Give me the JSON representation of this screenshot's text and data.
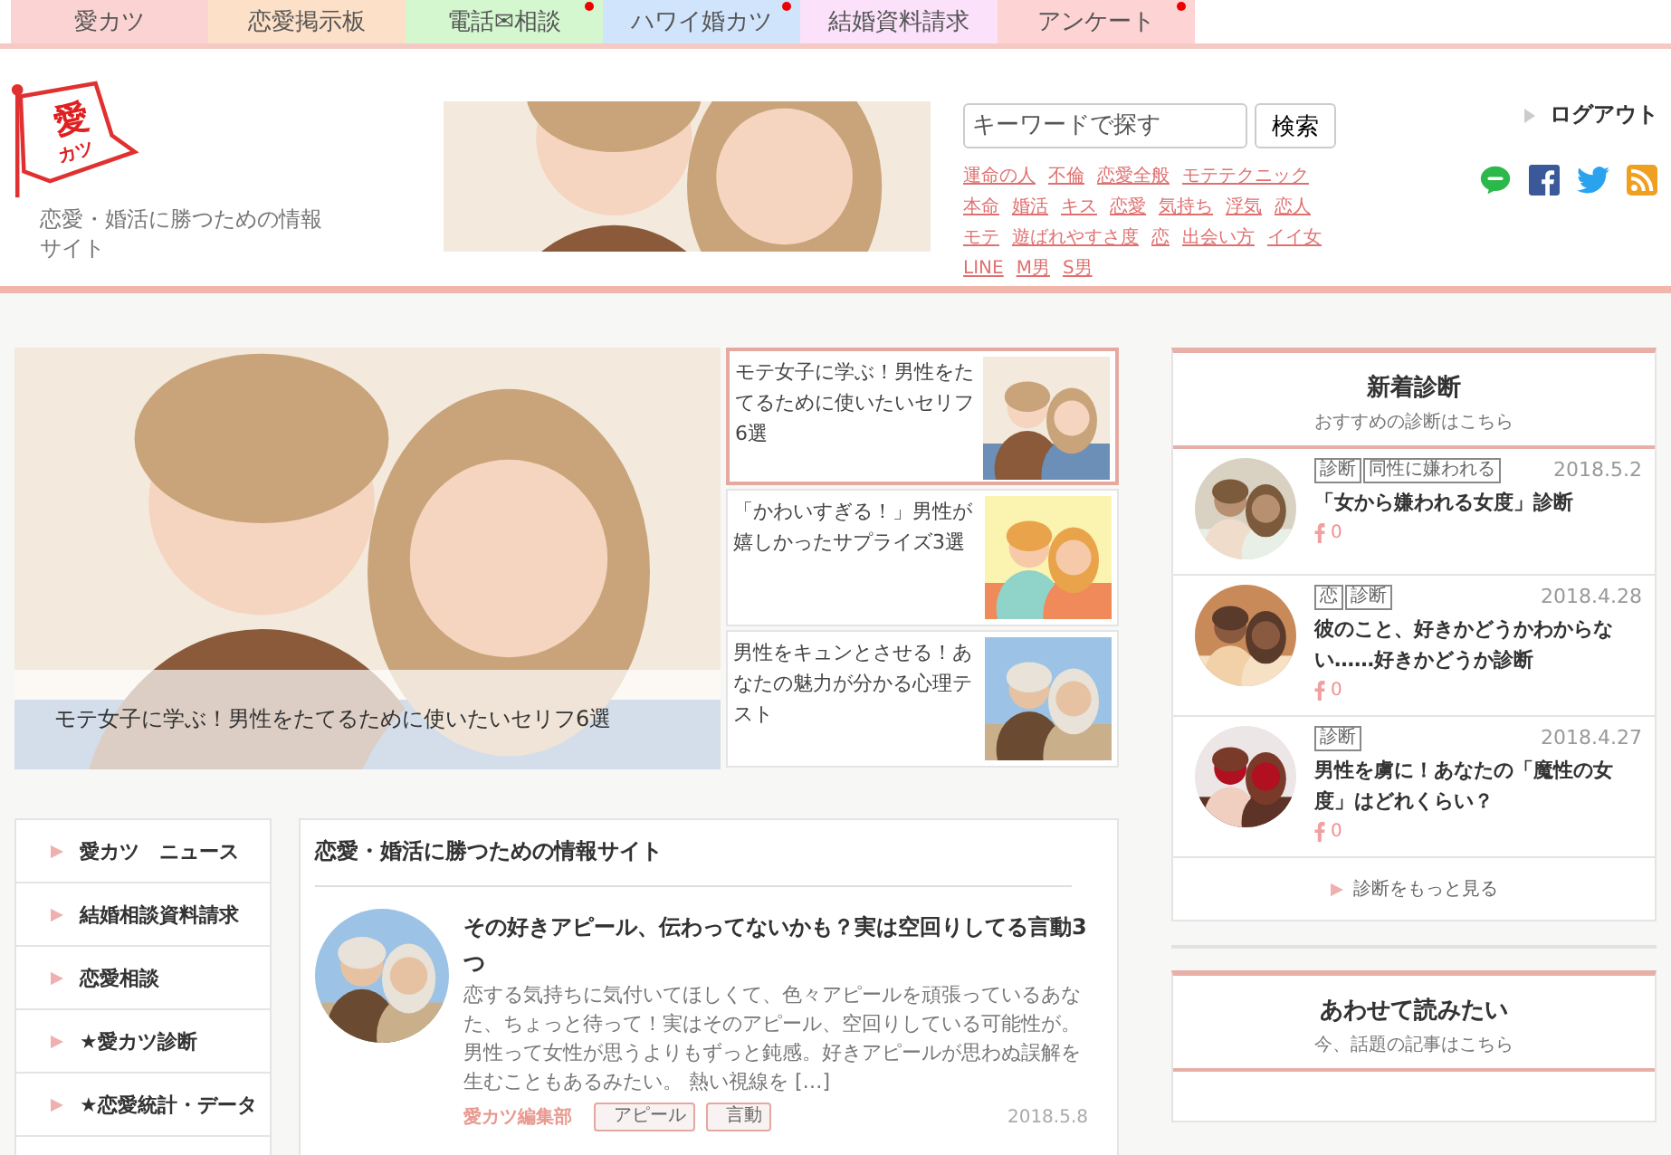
{
  "nav_tabs": [
    {
      "label": "愛カツ",
      "color": "#fcd3d3",
      "dot": false
    },
    {
      "label": "恋愛掲示板",
      "color": "#fde0c8",
      "dot": false
    },
    {
      "label": "電話✉相談",
      "color": "#d4f7cf",
      "dot": true
    },
    {
      "label": "ハワイ婚カツ",
      "color": "#d0e4fb",
      "dot": true
    },
    {
      "label": "結婚資料請求",
      "color": "#fbe1fa",
      "dot": false
    },
    {
      "label": "アンケート",
      "color": "#fdd3d3",
      "dot": true
    }
  ],
  "header": {
    "logo": {
      "line1": "愛",
      "line2": "カツ"
    },
    "tagline": "恋愛・婚活に勝つための情報サイト",
    "search": {
      "placeholder": "キーワードで探す",
      "button": "検索"
    },
    "keywords": [
      [
        "運命の人",
        "不倫",
        "恋愛全般",
        "モテテクニック"
      ],
      [
        "本命",
        "婚活",
        "キス",
        "恋愛",
        "気持ち",
        "浮気",
        "恋人"
      ],
      [
        "モテ",
        "遊ばれやすさ度",
        "恋",
        "出会い方",
        "イイ女"
      ],
      [
        "LINE",
        "M男",
        "S男"
      ]
    ],
    "login": "ログアウト"
  },
  "featured": {
    "caption": "モテ女子に学ぶ！男性をたてるために使いたいセリフ6選",
    "items": [
      {
        "title": "モテ女子に学ぶ！男性をたてるために使いたいセリフ6選",
        "selected": true
      },
      {
        "title": "「かわいすぎる！」男性が嬉しかったサプライズ3選",
        "selected": false
      },
      {
        "title": "男性をキュンとさせる！あなたの魅力が分かる心理テスト",
        "selected": false
      }
    ]
  },
  "sidebar_menu": [
    "愛カツ　ニュース",
    "結婚相談資料請求",
    "恋愛相談",
    "★愛カツ診断",
    "★恋愛統計・データ"
  ],
  "main_section": {
    "title": "恋愛・婚活に勝つための情報サイト",
    "articles": [
      {
        "title": "その好きアピール、伝わってないかも？実は空回りしてる言動3つ",
        "excerpt": "恋する気持ちに気付いてほしくて、色々アピールを頑張っているあなた、ちょっと待って！実はそのアピール、空回りしている可能性が。男性って女性が思うよりもずっと鈍感。好きアピールが思わぬ誤解を生むこともあるみたい。 熱い視線を […]",
        "author": "愛カツ編集部",
        "tags": [
          "アピール",
          "言動"
        ],
        "date": "2018.5.8"
      }
    ]
  },
  "new_diagnosis": {
    "title": "新着診断",
    "subtitle": "おすすめの診断はこちら",
    "items": [
      {
        "tags": [
          "診断",
          "同性に嫌われる"
        ],
        "date": "2018.5.2",
        "title": "「女から嫌われる女度」診断",
        "likes": "0"
      },
      {
        "tags": [
          "恋",
          "診断"
        ],
        "date": "2018.4.28",
        "title": "彼のこと、好きかどうかわからない……好きかどうか診断",
        "likes": "0"
      },
      {
        "tags": [
          "診断"
        ],
        "date": "2018.4.27",
        "title": "男性を虜に！あなたの「魔性の女度」はどれくらい？",
        "likes": "0"
      }
    ],
    "more": "診断をもっと見る"
  },
  "related": {
    "title": "あわせて読みたい",
    "subtitle": "今、話題の記事はこちら"
  }
}
